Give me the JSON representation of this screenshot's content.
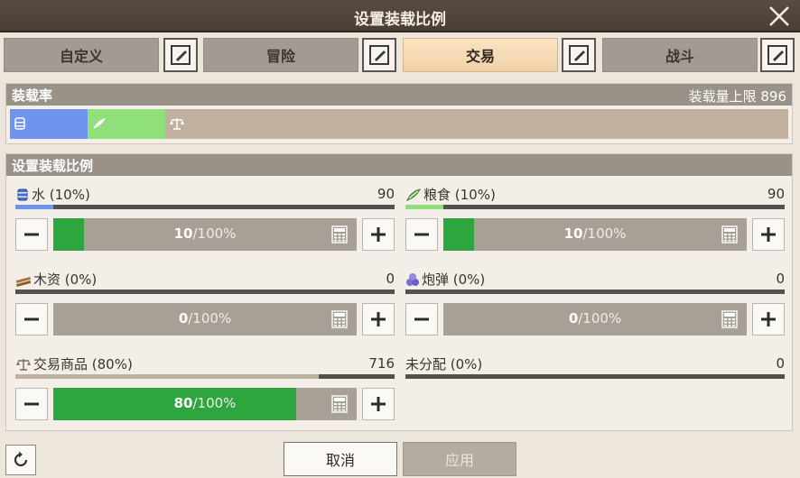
{
  "title": "设置装载比例",
  "tabs": [
    {
      "label": "自定义",
      "active": false
    },
    {
      "label": "冒险",
      "active": false
    },
    {
      "label": "交易",
      "active": true
    },
    {
      "label": "战斗",
      "active": false
    }
  ],
  "load_rate": {
    "heading": "装载率",
    "capacity_label": "装载量上限 896",
    "segments": [
      {
        "name": "水",
        "fraction": 0.1,
        "color": "#6f94f0",
        "icon": "water-barrel-icon"
      },
      {
        "name": "粮食",
        "fraction": 0.1,
        "color": "#8fe07a",
        "icon": "grain-icon"
      },
      {
        "name": "交易商品",
        "fraction": 0.8,
        "color": "#c3b19f",
        "icon": "scales-icon"
      }
    ]
  },
  "settings": {
    "heading": "设置装载比例",
    "resources": [
      {
        "label": "水 (10%)",
        "amount": "90",
        "fraction": 0.1,
        "bar_color": "#6f94f0",
        "value": "10",
        "unit": "/100%",
        "icon": "water-barrel-icon"
      },
      {
        "label": "粮食 (10%)",
        "amount": "90",
        "fraction": 0.1,
        "bar_color": "#8fe07a",
        "value": "10",
        "unit": "/100%",
        "icon": "grain-icon"
      },
      {
        "label": "木资 (0%)",
        "amount": "0",
        "fraction": 0.0,
        "bar_color": "#a07a4a",
        "value": "0",
        "unit": "/100%",
        "icon": "lumber-icon"
      },
      {
        "label": "炮弹 (0%)",
        "amount": "0",
        "fraction": 0.0,
        "bar_color": "#8a7ad8",
        "value": "0",
        "unit": "/100%",
        "icon": "cannonball-icon"
      },
      {
        "label": "交易商品 (80%)",
        "amount": "716",
        "fraction": 0.8,
        "bar_color": "#bdb1a2",
        "value": "80",
        "unit": "/100%",
        "icon": "scales-icon"
      }
    ],
    "unallocated": {
      "label": "未分配 (0%)",
      "amount": "0",
      "fraction": 0.0
    }
  },
  "buttons": {
    "cancel": "取消",
    "apply": "应用"
  }
}
